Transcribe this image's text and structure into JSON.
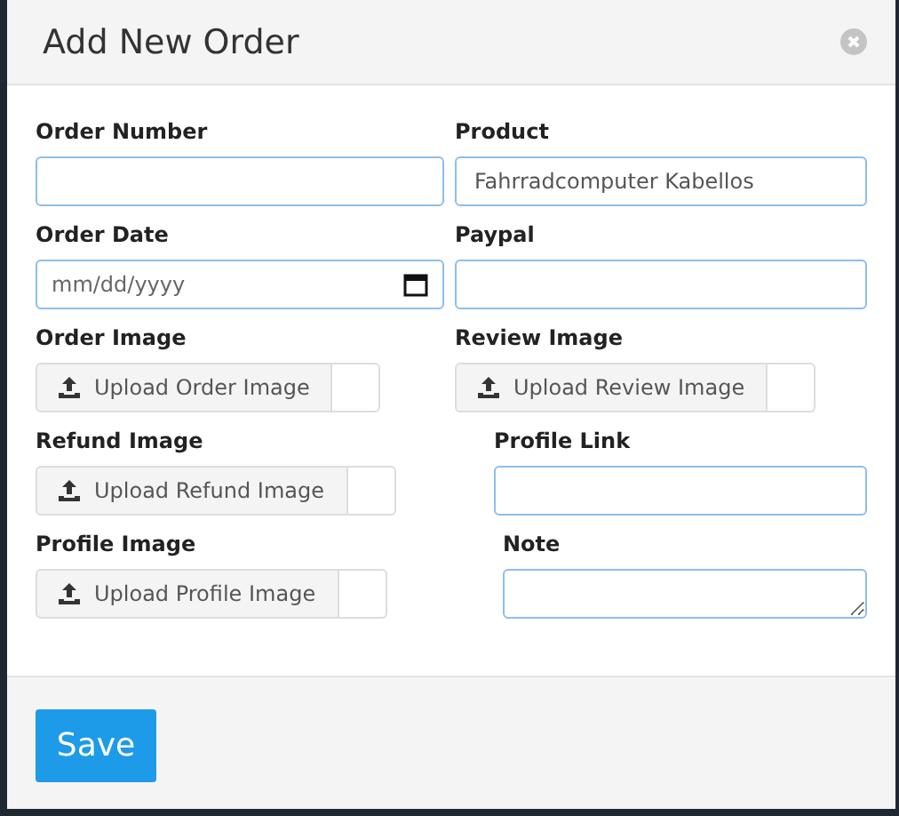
{
  "dialog": {
    "title": "Add New Order"
  },
  "fields": [
    {
      "kind": "text",
      "label": "Order Number"
    },
    {
      "kind": "text",
      "label": "Product",
      "value": "Fahrradcomputer Kabellos"
    },
    {
      "kind": "date",
      "label": "Order Date",
      "placeholder": "mm/dd/yyyy"
    },
    {
      "kind": "text",
      "label": "Paypal"
    },
    {
      "kind": "file",
      "label": "Order Image",
      "button": "Upload Order Image"
    },
    {
      "kind": "file",
      "label": "Review Image",
      "button": "Upload Review Image"
    },
    {
      "kind": "file",
      "label": "Refund Image",
      "button": "Upload Refund Image"
    },
    {
      "kind": "text",
      "label": "Profile Link"
    },
    {
      "kind": "file",
      "label": "Profile Image",
      "button": "Upload Profile Image"
    },
    {
      "kind": "textarea",
      "label": "Note"
    }
  ],
  "footer": {
    "save_button": "Save"
  }
}
